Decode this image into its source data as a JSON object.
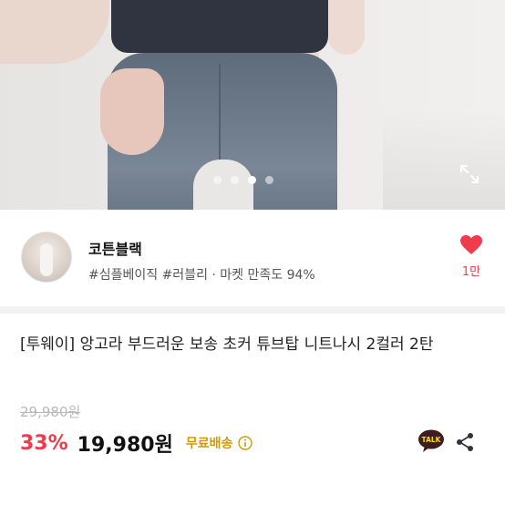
{
  "gallery": {
    "dots": [
      {
        "active": false
      },
      {
        "active": false
      },
      {
        "active": true
      },
      {
        "active": false
      }
    ],
    "expand_icon": "expand-icon"
  },
  "seller": {
    "name": "코튼블랙",
    "tags": "#심플베이직 #러블리 · 마켓 만족도 94%",
    "like_count": "1만"
  },
  "product": {
    "title": "[투웨이] 앙고라 부드러운 보송 초커 튜브탑 니트나시 2컬러 2탄",
    "original_price": "29,980원",
    "discount": "33%",
    "price": "19,980원",
    "shipping": "무료배송"
  },
  "actions": {
    "talk_label": "TALK"
  },
  "colors": {
    "accent_red": "#ef3b4b",
    "shipping_gold": "#d19a00",
    "kakao_yellow": "#f9e000"
  }
}
